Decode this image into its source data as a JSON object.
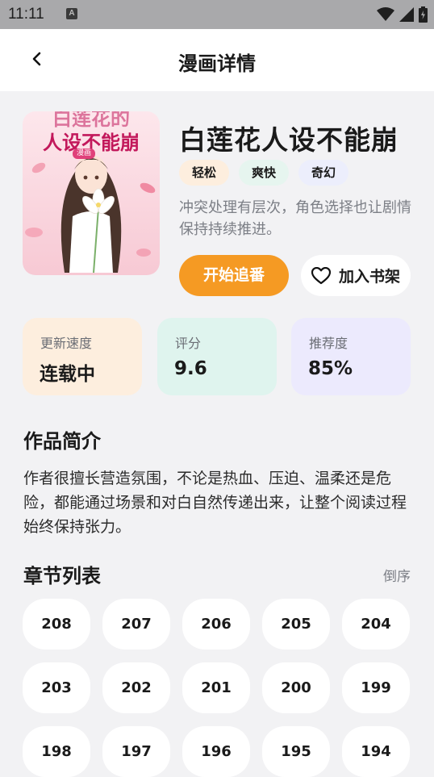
{
  "status_bar": {
    "time": "11:11",
    "notification_letter": "A"
  },
  "header": {
    "title": "漫画详情"
  },
  "cover": {
    "title_lines": [
      "白莲花的",
      "人设不能崩"
    ],
    "badge": "漫画"
  },
  "comic": {
    "title": "白莲花人设不能崩",
    "tags": [
      {
        "label": "轻松",
        "bg": "#fdeede"
      },
      {
        "label": "爽快",
        "bg": "#e6f5ef"
      },
      {
        "label": "奇幻",
        "bg": "#eceefc"
      }
    ],
    "short_desc": "冲突处理有层次，角色选择也让剧情保持持续推进。"
  },
  "actions": {
    "start_label": "开始追番",
    "bookshelf_label": "加入书架"
  },
  "stats": [
    {
      "label": "更新速度",
      "value": "连载中",
      "bg": "#fdeede"
    },
    {
      "label": "评分",
      "value": "9.6",
      "bg": "#dff4ee"
    },
    {
      "label": "推荐度",
      "value": "85%",
      "bg": "#eceafd"
    }
  ],
  "intro": {
    "heading": "作品简介",
    "text": "作者很擅长营造氛围，不论是热血、压迫、温柔还是危险，都能通过场景和对白自然传递出来，让整个阅读过程始终保持张力。"
  },
  "chapters": {
    "heading": "章节列表",
    "order_label": "倒序",
    "items": [
      "208",
      "207",
      "206",
      "205",
      "204",
      "203",
      "202",
      "201",
      "200",
      "199",
      "198",
      "197",
      "196",
      "195",
      "194"
    ]
  },
  "colors": {
    "accent": "#f59a23"
  }
}
